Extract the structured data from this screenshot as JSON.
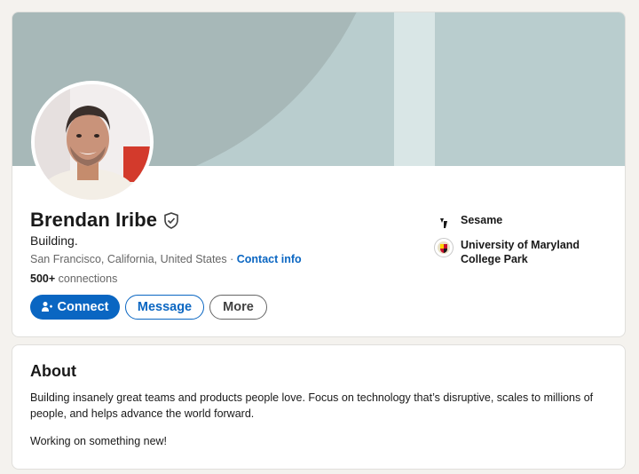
{
  "profile": {
    "name": "Brendan Iribe",
    "headline": "Building.",
    "location": "San Francisco, California, United States",
    "separator": " · ",
    "contact_label": "Contact info",
    "connections_count": "500+",
    "connections_label": " connections",
    "verified_icon": "verified-shield-icon"
  },
  "actions": {
    "connect_label": "Connect",
    "message_label": "Message",
    "more_label": "More"
  },
  "organizations": [
    {
      "name": "Sesame",
      "logo": "sesame-logo"
    },
    {
      "name_line1": "University of Maryland",
      "name_line2": "College Park",
      "logo": "umd-seal"
    }
  ],
  "about": {
    "title": "About",
    "text": "Building insanely great teams and products people love. Focus on technology that’s disruptive, scales to millions of people, and helps advance the world forward.",
    "text2": "Working on something new!"
  },
  "colors": {
    "accent": "#0a66c2",
    "banner": "#b9cdce",
    "page_bg": "#f4f2ee"
  }
}
